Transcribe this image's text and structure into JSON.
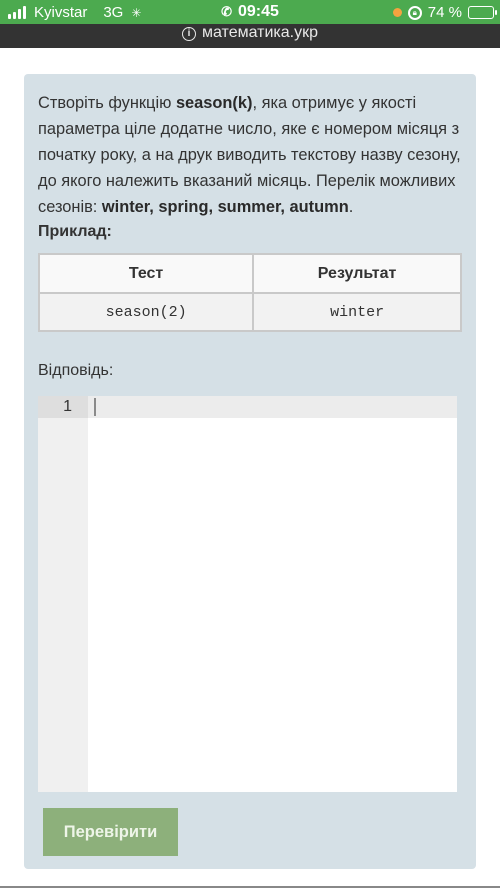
{
  "status_bar": {
    "carrier": "Kyivstar",
    "network": "3G",
    "time": "09:45",
    "battery_percent_label": "74 %",
    "battery_level": 0.74
  },
  "browser": {
    "url": "математика.укр"
  },
  "task": {
    "description_parts": {
      "p1": "Створіть функцію ",
      "b1": "season(k)",
      "p2": ", яка отримує у якості параметра ціле додатне число, яке є номером місяця з початку року, а на друк виводить текстову назву сезону, до якого належить вказаний місяць. Перелік можливих сезонів: ",
      "b2": "winter, spring, summer, autumn",
      "p3": "."
    },
    "example_label": "Приклад:",
    "table": {
      "headers": [
        "Тест",
        "Результат"
      ],
      "rows": [
        [
          "season(2)",
          "winter"
        ]
      ]
    },
    "answer_label": "Відповідь:",
    "editor": {
      "line_numbers": [
        "1"
      ],
      "content": ""
    },
    "check_button": "Перевірити"
  },
  "colors": {
    "status_bar": "#4caa4f",
    "url_bar": "#333333",
    "card": "#d5e0e6",
    "button": "#8db07b"
  }
}
